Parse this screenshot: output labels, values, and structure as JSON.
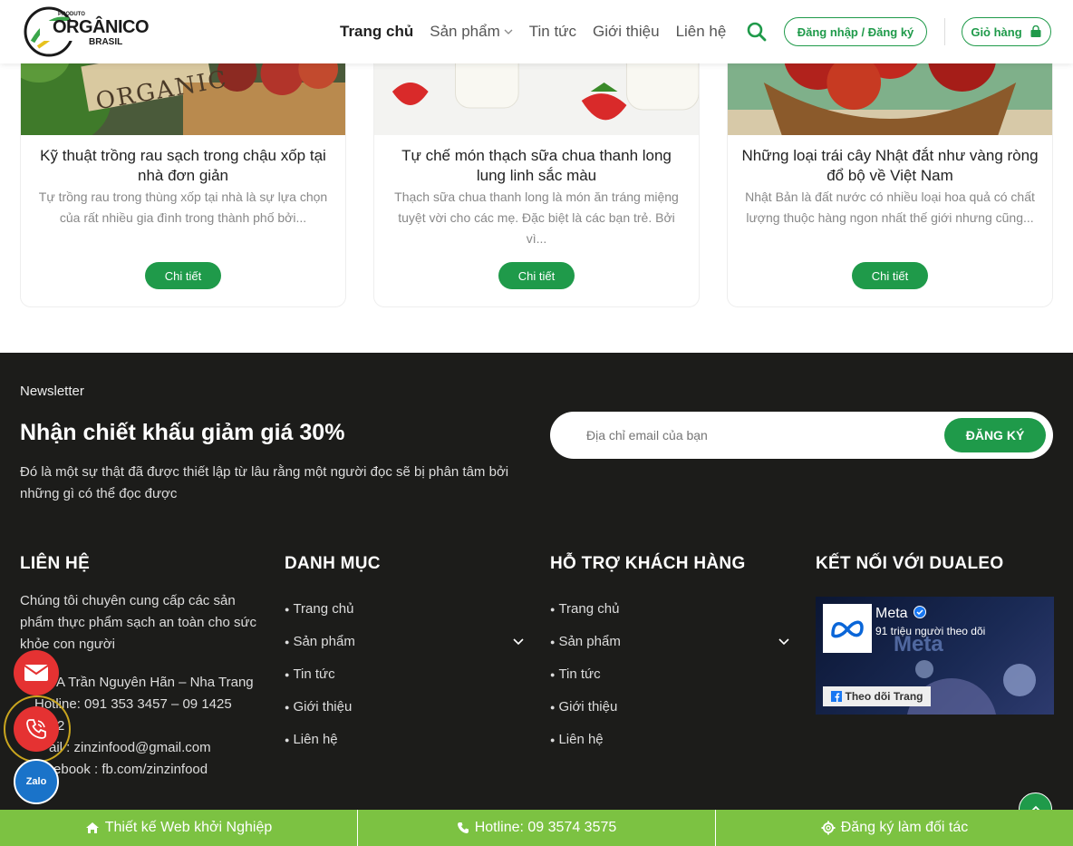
{
  "header": {
    "logo": {
      "top": "PRODUTO",
      "main": "ORGÂNICO",
      "sub": "BRASIL"
    },
    "nav": [
      {
        "label": "Trang chủ",
        "active": true
      },
      {
        "label": "Sản phẩm",
        "dropdown": true
      },
      {
        "label": "Tin tức"
      },
      {
        "label": "Giới thiệu"
      },
      {
        "label": "Liên hệ"
      }
    ],
    "login_label": "Đăng nhập / Đăng ký",
    "cart_label": "Giỏ hàng"
  },
  "posts": [
    {
      "title": "Kỹ thuật trồng rau sạch trong chậu xốp tại nhà đơn giản",
      "excerpt": "Tự trồng rau trong thùng xốp tại nhà là sự lựa chọn của rất nhiều gia đình trong thành phố bởi...",
      "button": "Chi tiết",
      "image_text": "ORGANIC"
    },
    {
      "title": "Tự chế món thạch sữa chua thanh long lung linh sắc màu",
      "excerpt": "Thạch sữa chua thanh long là món ăn tráng miệng tuyệt vời cho các mẹ. Đặc biệt là các bạn trẻ. Bởi vì...",
      "button": "Chi tiết"
    },
    {
      "title": "Những loại trái cây Nhật đắt như vàng ròng đổ bộ về Việt Nam",
      "excerpt": "Nhật Bản là đất nước có nhiều loại hoa quả có chất lượng thuộc hàng ngon nhất thế giới nhưng cũng...",
      "button": "Chi tiết"
    }
  ],
  "newsletter": {
    "label": "Newsletter",
    "title": "Nhận chiết khấu giảm giá 30%",
    "desc": "Đó là một sự thật đã được thiết lập từ lâu rằng một người đọc sẽ bị phân tâm bởi những gì có thể đọc được",
    "placeholder": "Địa chỉ email của bạn",
    "submit": "ĐĂNG KÝ"
  },
  "footer": {
    "contact": {
      "title": "LIÊN HỆ",
      "desc": "Chúng tôi chuyên cung cấp các sản phẩm thực phẩm sạch an toàn cho sức khỏe con người",
      "address": "A Trần Nguyên Hãn – Nha Trang",
      "hotline": "Hotline: 091 353 3457 – 09 1425 2542",
      "email": "ail : zinzinfood@gmail.com",
      "facebook": "Facebook : fb.com/zinzinfood"
    },
    "categories": {
      "title": "DANH MỤC",
      "items": [
        "Trang chủ",
        "Sản phẩm",
        "Tin tức",
        "Giới thiệu",
        "Liên hệ"
      ]
    },
    "support": {
      "title": "HỖ TRỢ KHÁCH HÀNG",
      "items": [
        "Trang chủ",
        "Sản phẩm",
        "Tin tức",
        "Giới thiệu",
        "Liên hệ"
      ]
    },
    "connect": {
      "title": "KẾT NỐI VỚI DUALEO",
      "page_name": "Meta",
      "followers": "91 triệu người theo dõi",
      "follow_btn": "Theo dõi Trang",
      "watermark": "Meta"
    }
  },
  "floating": {
    "zalo": "Zalo"
  },
  "bottom_bar": [
    {
      "label": "Thiết kế Web khởi Nghiệp",
      "icon": "home-icon"
    },
    {
      "label": "Hotline: 09 3574 3575",
      "icon": "phone-icon"
    },
    {
      "label": "Đăng ký làm đối tác",
      "icon": "gear-icon"
    }
  ],
  "colors": {
    "green": "#1f9a4a",
    "bar_green": "#7cc242",
    "footer_bg": "#1c1c1a",
    "red": "#e53232"
  }
}
